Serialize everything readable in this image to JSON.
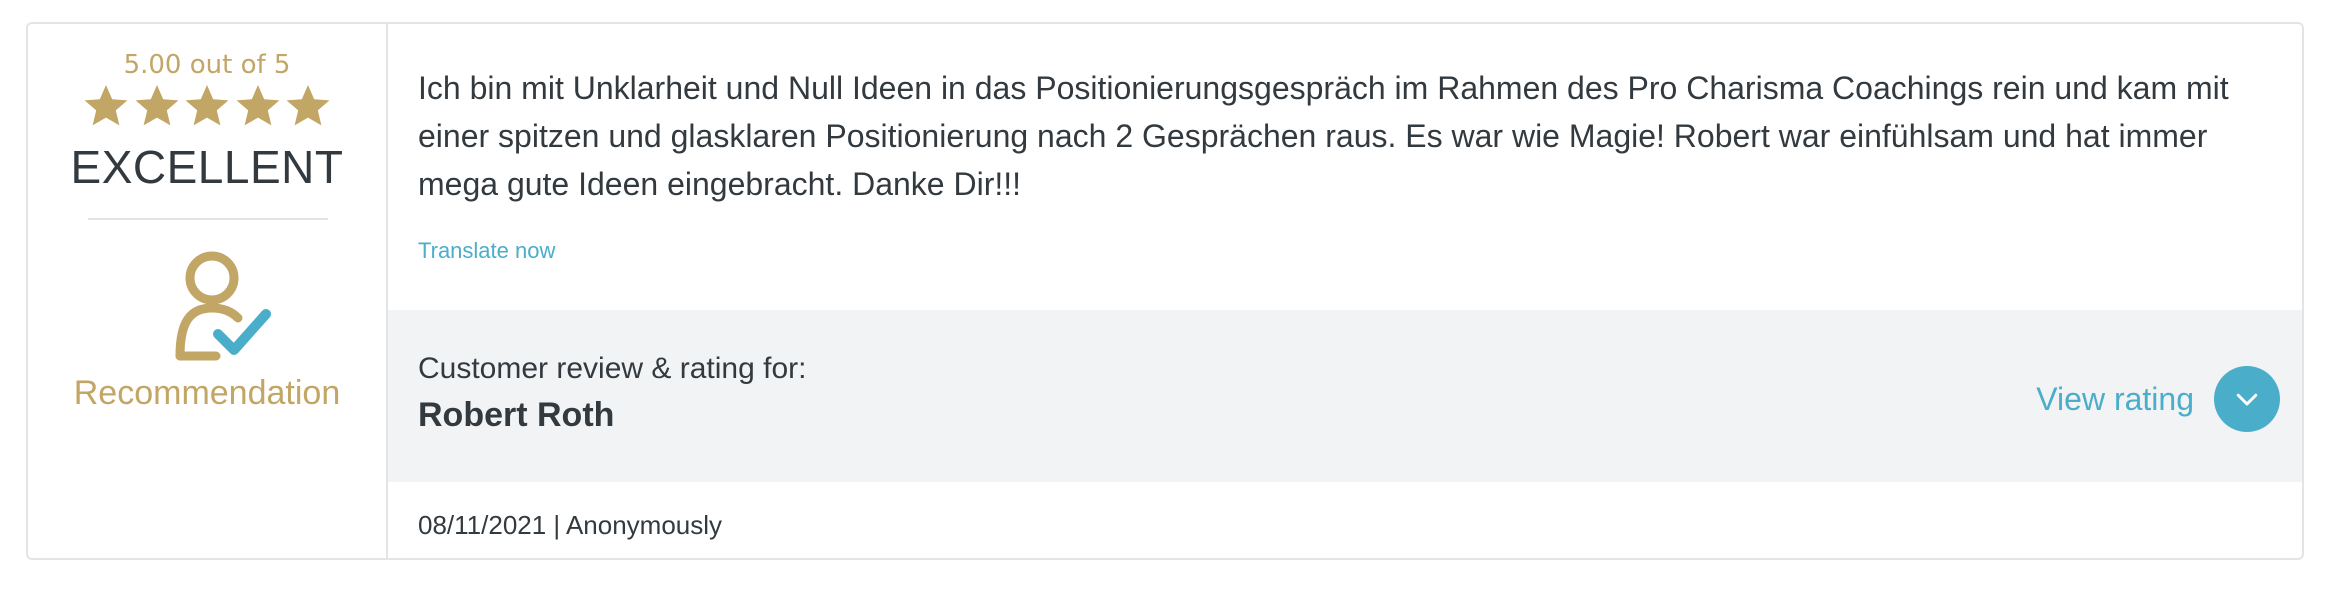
{
  "rating": {
    "score_text": "5.00 out of 5",
    "stars_filled": 5,
    "stars_total": 5,
    "verdict": "EXCELLENT",
    "recommendation_label": "Recommendation"
  },
  "review": {
    "text": "Ich bin mit Unklarheit und Null Ideen in das Positionierungsgespräch im Rahmen des Pro Charisma Coachings rein und kam mit einer spitzen und glasklaren Positionierung nach 2 Gesprächen raus. Es war wie Magie! Robert war einfühlsam und hat immer mega gute Ideen eingebracht. Danke Dir!!!",
    "translate_link": "Translate now"
  },
  "subject": {
    "label": "Customer review & rating for:",
    "name": "Robert Roth",
    "view_rating_label": "View rating"
  },
  "meta": {
    "footer": "08/11/2021 | Anonymously"
  },
  "colors": {
    "gold": "#c2a665",
    "accent": "#4aaecb",
    "text": "#333a3f",
    "band": "#f2f3f4"
  },
  "icons": {
    "star": "star-icon",
    "recommendation": "user-check-icon",
    "expand": "chevron-down-icon"
  }
}
